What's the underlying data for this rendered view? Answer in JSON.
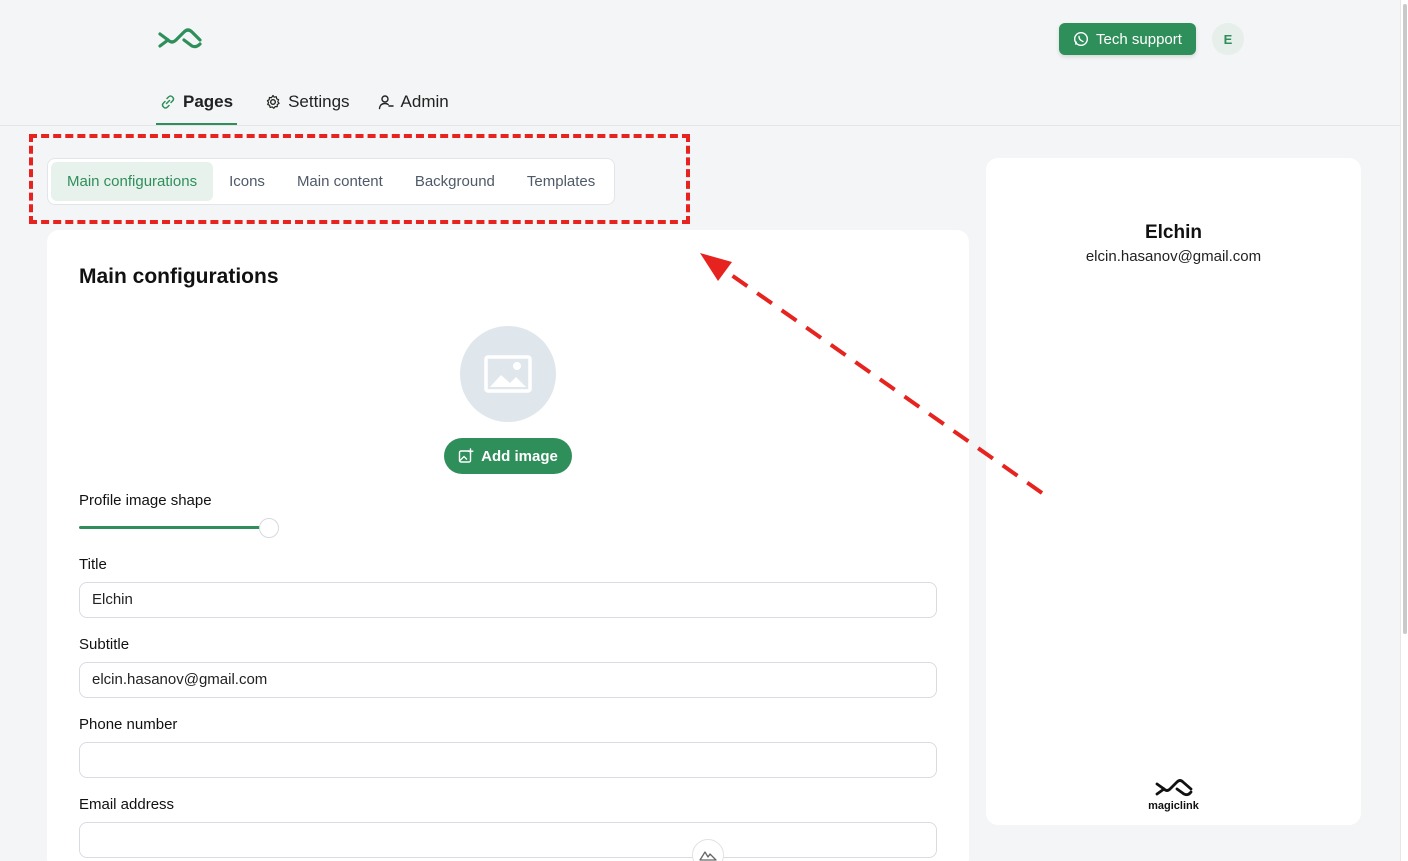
{
  "header": {
    "logo_icon": "magiclink-logo-icon",
    "tech_support_label": "Tech support",
    "tech_support_icon": "whatsapp-icon",
    "avatar_initial": "E",
    "brand_color": "#2f8f5b"
  },
  "nav": {
    "items": [
      {
        "label": "Pages",
        "icon": "link-icon",
        "active": true
      },
      {
        "label": "Settings",
        "icon": "gear-icon",
        "active": false
      },
      {
        "label": "Admin",
        "icon": "user-icon",
        "active": false
      }
    ]
  },
  "tabs": [
    {
      "label": "Main configurations",
      "active": true
    },
    {
      "label": "Icons",
      "active": false
    },
    {
      "label": "Main content",
      "active": false
    },
    {
      "label": "Background",
      "active": false
    },
    {
      "label": "Templates",
      "active": false
    }
  ],
  "form": {
    "heading": "Main configurations",
    "add_image_label": "Add image",
    "profile_shape_label": "Profile image shape",
    "profile_shape_value": 1.0,
    "title_label": "Title",
    "title_value": "Elchin",
    "subtitle_label": "Subtitle",
    "subtitle_value": "elcin.hasanov@gmail.com",
    "phone_label": "Phone number",
    "phone_value": "",
    "email_label": "Email address",
    "email_value": ""
  },
  "preview": {
    "name": "Elchin",
    "email": "elcin.hasanov@gmail.com",
    "footer_brand": "magiclink"
  },
  "annotation": {
    "highlight_color": "#e6231f"
  }
}
